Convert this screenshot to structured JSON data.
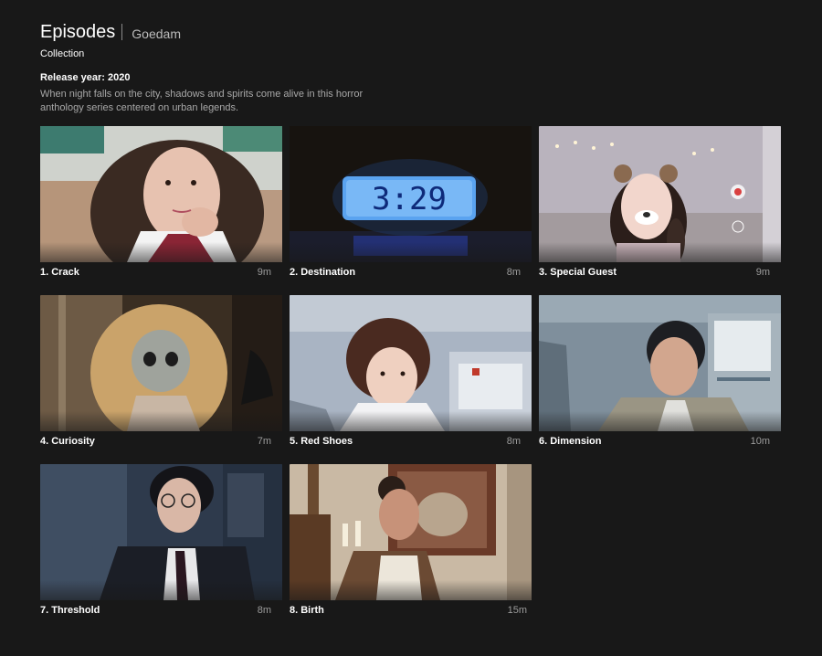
{
  "header": {
    "title": "Episodes",
    "show_name": "Goedam",
    "collection_label": "Collection",
    "release_label": "Release year: 2020",
    "synopsis": "When night falls on the city, shadows and spirits come alive in this horror anthology series centered on urban legends."
  },
  "episodes": [
    {
      "title": "1. Crack",
      "duration": "9m"
    },
    {
      "title": "2. Destination",
      "duration": "8m"
    },
    {
      "title": "3. Special Guest",
      "duration": "9m"
    },
    {
      "title": "4. Curiosity",
      "duration": "7m"
    },
    {
      "title": "5. Red Shoes",
      "duration": "8m"
    },
    {
      "title": "6. Dimension",
      "duration": "10m"
    },
    {
      "title": "7. Threshold",
      "duration": "8m"
    },
    {
      "title": "8. Birth",
      "duration": "15m"
    }
  ],
  "thumbnails": {
    "clock_display": "3:29"
  },
  "colors": {
    "background": "#181818",
    "text_primary": "#ffffff",
    "text_secondary": "#a8a8a8",
    "clock_glow": "#3a8ee8"
  }
}
